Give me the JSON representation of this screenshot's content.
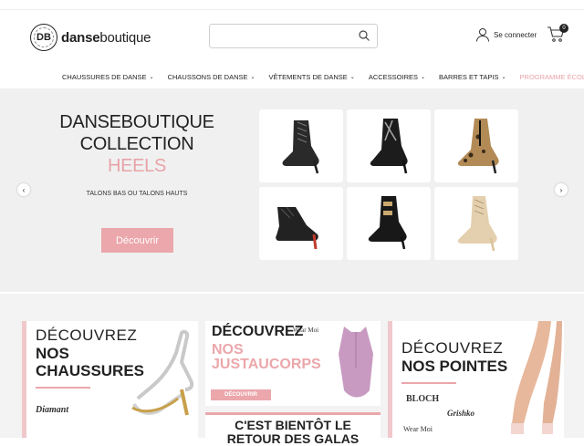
{
  "header": {
    "logo_bold": "danse",
    "logo_rest": "boutique",
    "logo_badge": "DB",
    "search_placeholder": "",
    "account_label": "Se connecter",
    "cart_count": "0"
  },
  "nav": [
    {
      "label": "CHAUSSURES DE DANSE",
      "chevron": "⌄"
    },
    {
      "label": "CHAUSSONS DE DANSE",
      "chevron": "⌄"
    },
    {
      "label": "VÊTEMENTS DE DANSE",
      "chevron": "⌄"
    },
    {
      "label": "ACCESSOIRES",
      "chevron": "⌄"
    },
    {
      "label": "BARRES ET TAPIS",
      "chevron": "⌄"
    },
    {
      "label": "PROGRAMME ÉCOLE",
      "chevron": ""
    }
  ],
  "hero": {
    "title_line1": "DANSEBOUTIQUE",
    "title_line2": "COLLECTION",
    "title_line3": "HEELS",
    "subtitle": "TALONS BAS OU TALONS HAUTS",
    "button": "Découvrir",
    "prev": "‹",
    "next": "›"
  },
  "promos": {
    "p1_line1": "DÉCOUVREZ",
    "p1_line2": "NOS",
    "p1_line3": "CHAUSSURES",
    "p1_brand1": "Diamant",
    "p2_line1": "DÉCOUVREZ",
    "p2_line2": "NOS JUSTAUCORPS",
    "p2_button": "DÉCOUVRIR",
    "p2_brand1": "Wear Moi",
    "p3_line1": "DÉCOUVREZ",
    "p3_line2": "NOS POINTES",
    "p3_brand1": "BLOCH",
    "p3_brand2": "Grishko",
    "p3_brand3": "Wear Moi",
    "p4_line1": "C'EST BIENTÔT LE",
    "p4_line2": "RETOUR DES GALAS"
  },
  "colors": {
    "accent_pink": "#eba7ab",
    "hero_bg": "#f0f0f0"
  }
}
